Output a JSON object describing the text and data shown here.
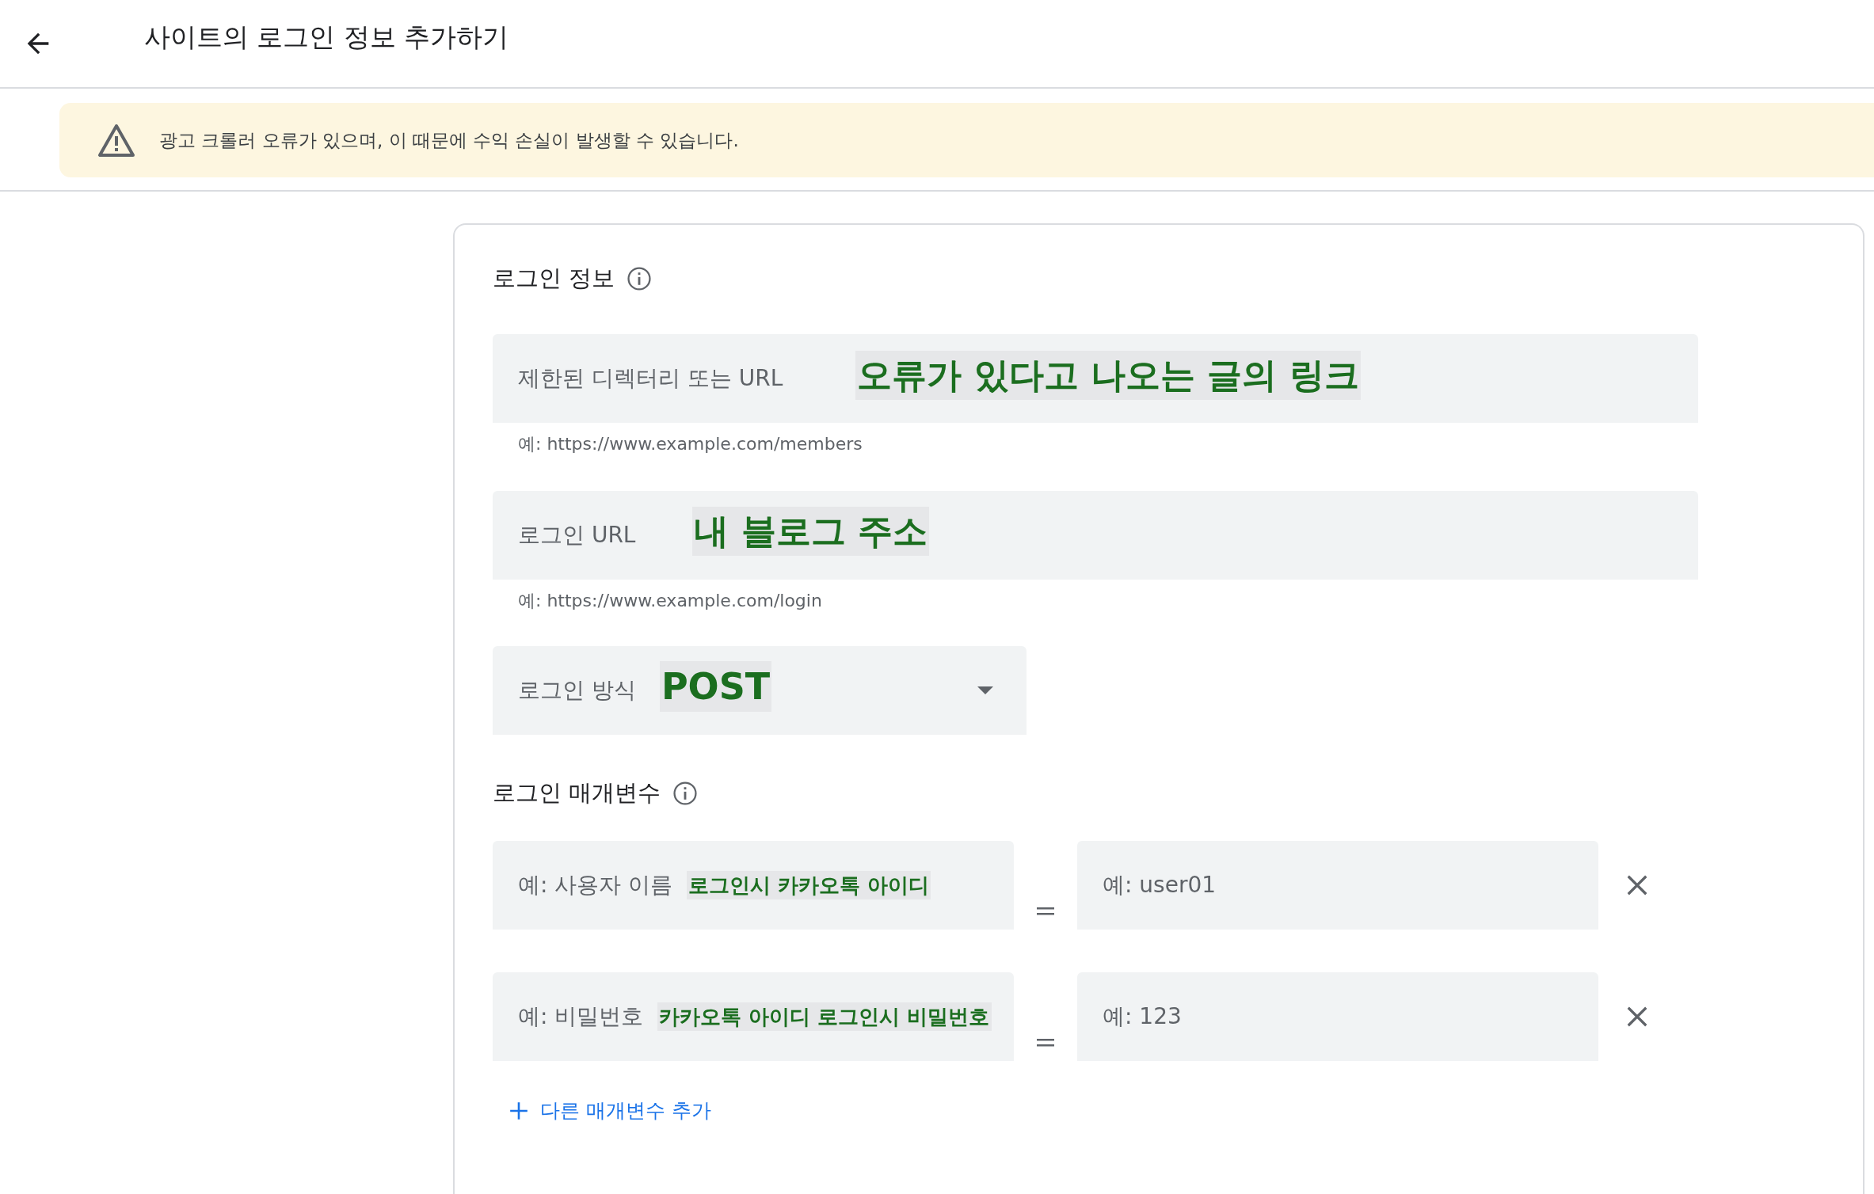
{
  "header": {
    "title": "사이트의 로그인 정보 추가하기"
  },
  "banner": {
    "message": "광고 크롤러 오류가 있으며, 이 때문에 수익 손실이 발생할 수 있습니다."
  },
  "login_info": {
    "title": "로그인 정보",
    "fields": [
      {
        "label": "제한된 디렉터리 또는 URL",
        "annotation": "오류가 있다고 나오는 글의 링크",
        "helper": "예: https://www.example.com/members"
      },
      {
        "label": "로그인 URL",
        "annotation": "내 블로그 주소",
        "helper": "예: https://www.example.com/login"
      }
    ],
    "method": {
      "label": "로그인 방식",
      "annotation": "POST"
    }
  },
  "login_parameters": {
    "title": "로그인 매개변수",
    "rows": [
      {
        "name_placeholder": "예: 사용자 이름",
        "annotation": "로그인시 카카오톡 아이디",
        "value_placeholder": "예: user01"
      },
      {
        "name_placeholder": "예: 비밀번호",
        "annotation": "카카오톡 아이디 로그인시 비밀번호",
        "value_placeholder": "예: 123"
      }
    ],
    "add_button": "다른 매개변수 추가"
  }
}
